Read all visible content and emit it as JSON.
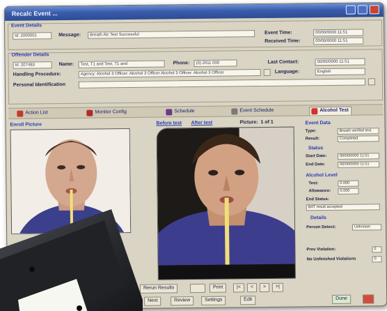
{
  "window": {
    "title": "Recalc Event ..."
  },
  "event_details": {
    "heading": "Event Details",
    "id_value": "Id: 2000001",
    "message_label": "Message:",
    "message_value": "Breath Alc Test Successful",
    "event_time_label": "Event Time:",
    "event_time_value": "00/00/0000 11:51",
    "received_time_label": "Received Time:",
    "received_time_value": "00/00/0000 11:51"
  },
  "offender_details": {
    "heading": "Offender Details",
    "id_value": "Id: 207483",
    "name_label": "Name:",
    "name_value": "Test, T1 and Test, T1 and",
    "phone_label": "Phone:",
    "phone_value": "(0) 2011 000",
    "last_contact_label": "Last Contact:",
    "last_contact_value": "00/00/0000 11:51",
    "handling_label": "Handling Procedure:",
    "handling_value": "Agency: Alcohol 3 Officer: Alcohol 3 Officer Alcohol 3 Officer: Alcohol 3 Officer",
    "language_label": "Language:",
    "language_value": "English",
    "personal_id_label": "Personal Identification"
  },
  "tabs": [
    {
      "label": "Action List",
      "icon": "list-icon",
      "color": "#c23c2a"
    },
    {
      "label": "Monitor Config",
      "icon": "config-icon",
      "color": "#b32a28"
    },
    {
      "label": "Schedule",
      "icon": "calendar-icon",
      "color": "#6a3b8c"
    },
    {
      "label": "Event Schedule",
      "icon": "clock-icon",
      "color": "#7a7a7a"
    },
    {
      "label": "Alcohol Test",
      "icon": "alcohol-icon",
      "color": "#d0332a"
    }
  ],
  "photos": {
    "enroll_label": "Enroll Picture",
    "current_label": "Before test",
    "after_label": "After test",
    "pager_label": "Picture:",
    "pager_value": "1 of 1"
  },
  "side": {
    "event_data_heading": "Event Data",
    "value_row1": "Breath verified test",
    "value_row2": "Completed",
    "status_heading": "Status",
    "start_label": "Start Date:",
    "start_value": "00/00/0000 11:51",
    "end_label": "End Date:",
    "end_value": "00/00/0000 11:51",
    "alcohol_heading": "Alcohol Level",
    "test_label": "Test:",
    "test_value": "0.000",
    "allowance_label": "Allowance:",
    "allowance_value": "0.000",
    "end_status_label": "End Status:",
    "end_status_value": "BAT result accepted",
    "details_heading": "Details",
    "detail_label": "Person Detect:",
    "detail_value": "Unknown",
    "prev_label": "Prev Violation:",
    "prev_value": "0",
    "no_reading_label": "No Unfinished Violations",
    "no_reading_value": "0"
  },
  "bottom": {
    "rerun_label": "Rerun Results",
    "print_label": "Print",
    "nav": [
      "|<",
      "<",
      ">",
      ">|"
    ],
    "next_label": "Next",
    "review_label": "Review",
    "settings_label": "Settings",
    "edit_label": "Edit",
    "done_label": "Done"
  },
  "colors": {
    "accent_title": "#2b3bb0",
    "titlebar": "#3a5cab"
  }
}
